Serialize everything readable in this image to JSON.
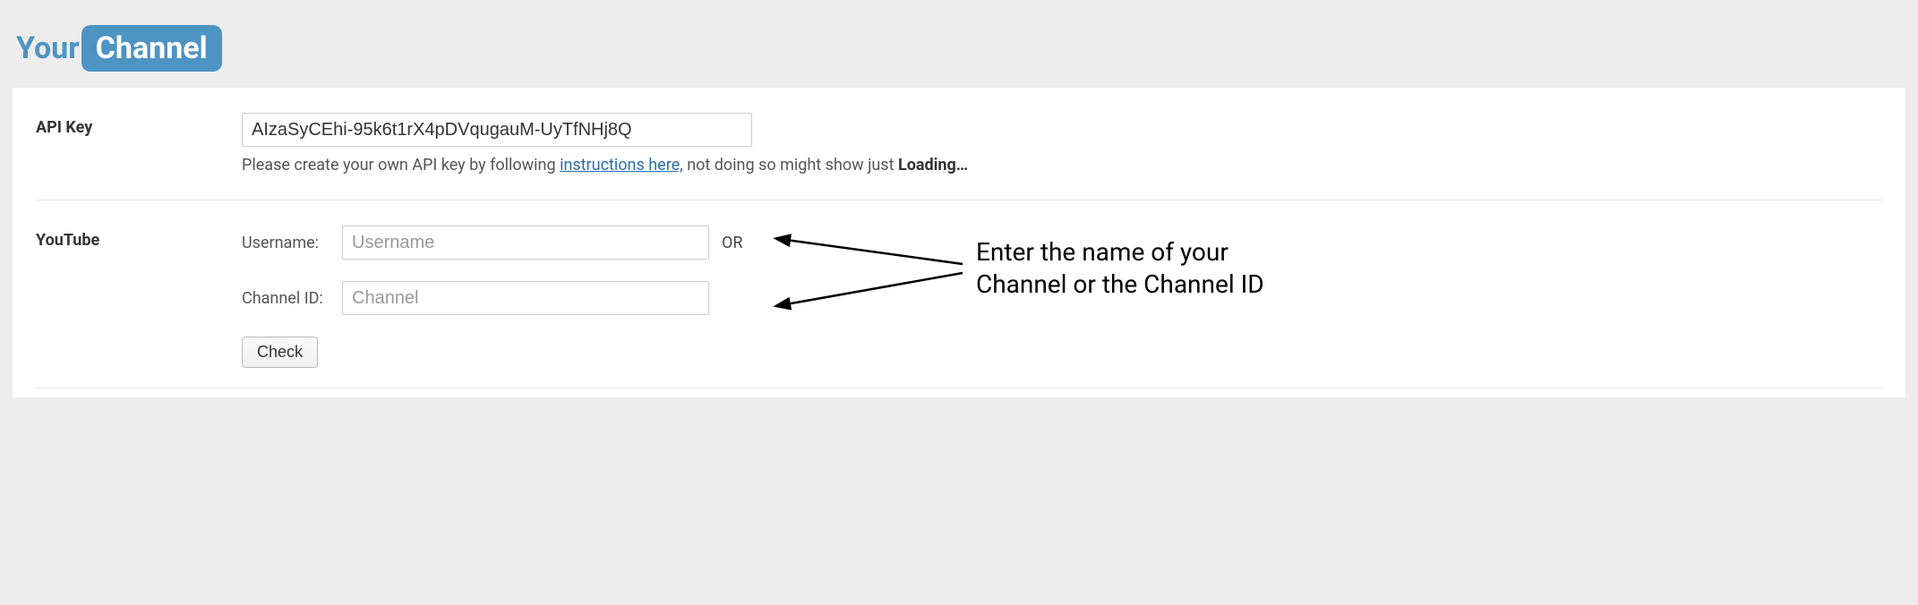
{
  "logo": {
    "left": "Your",
    "right": "Channel"
  },
  "api": {
    "label": "API Key",
    "value": "AIzaSyCEhi-95k6t1rX4pDVqugauM-UyTfNHj8Q",
    "help_pre": "Please create your own API key by following ",
    "help_link": "instructions here,",
    "help_post": " not doing so might show just ",
    "help_strong": "Loading…"
  },
  "youtube": {
    "label": "YouTube",
    "username_label": "Username:",
    "username_placeholder": "Username",
    "or": "OR",
    "channel_label": "Channel ID:",
    "channel_placeholder": "Channel",
    "check": "Check"
  },
  "annotation": "Enter the name of your\nChannel or the Channel ID"
}
